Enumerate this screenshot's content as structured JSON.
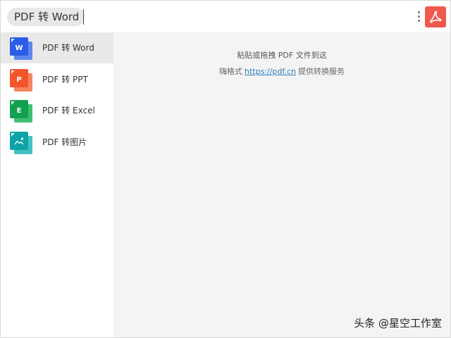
{
  "search": {
    "query": "PDF 转 Word"
  },
  "sidebar": {
    "items": [
      {
        "label": "PDF 转 Word",
        "letter": "W",
        "color": "#2b5ce6",
        "color_back": "#5d86f0",
        "active": true,
        "icon": "word-file-icon"
      },
      {
        "label": "PDF 转 PPT",
        "letter": "P",
        "color": "#f2552c",
        "color_back": "#f7845f",
        "active": false,
        "icon": "ppt-file-icon"
      },
      {
        "label": "PDF 转 Excel",
        "letter": "E",
        "color": "#12a150",
        "color_back": "#3fbf72",
        "active": false,
        "icon": "excel-file-icon"
      },
      {
        "label": "PDF 转图片",
        "letter": "",
        "color": "#0fa3a8",
        "color_back": "#43c1c3",
        "active": false,
        "icon": "image-file-icon"
      }
    ]
  },
  "main": {
    "hint_line1": "粘贴或拖拽 PDF 文件到这",
    "hint_line2_prefix": "嗨格式",
    "hint_link": "https://pdf.cn",
    "hint_line2_suffix": "提供转换服务"
  },
  "watermark": "头条 @星空工作室",
  "colors": {
    "accent_red": "#f0584d",
    "link_blue": "#2d7fc1",
    "sidebar_active_bg": "#e9e9e9",
    "main_bg": "#f4f4f4"
  },
  "icons": {
    "more": "more-vertical-icon",
    "pdf": "acrobat-pdf-icon"
  }
}
